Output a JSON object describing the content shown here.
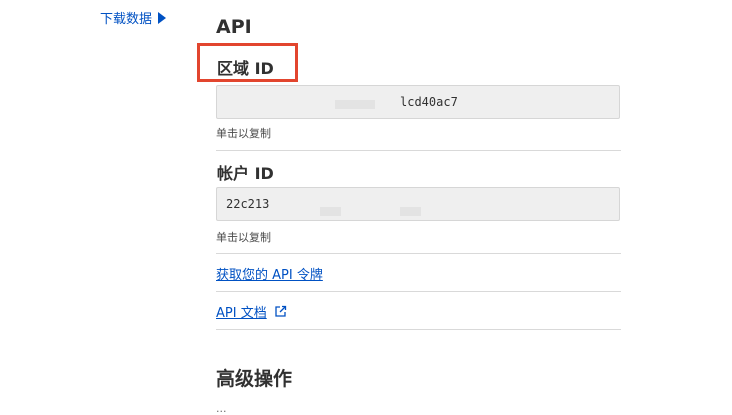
{
  "sidebar": {
    "download_label": "下载数据"
  },
  "api": {
    "title": "API",
    "zone": {
      "label": "区域 ID",
      "value": "lcd40ac7",
      "hint": "单击以复制"
    },
    "account": {
      "label": "帐户 ID",
      "value": "22c213",
      "hint": "单击以复制"
    },
    "token_link": "获取您的 API 令牌",
    "docs_link": "API 文档"
  },
  "advanced": {
    "title": "高级操作",
    "first_item_partial": "..."
  },
  "colors": {
    "link": "#0051c3",
    "highlight": "#e2452e",
    "field_bg": "#efefef"
  }
}
